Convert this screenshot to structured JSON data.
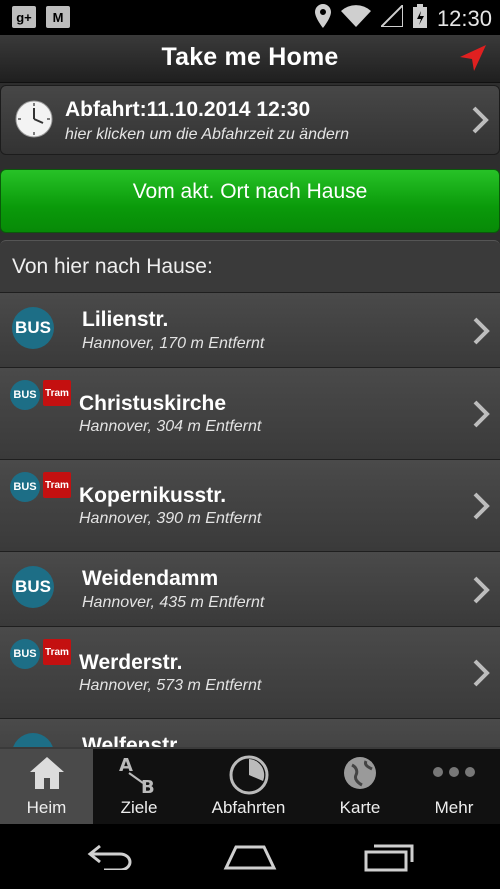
{
  "status_bar": {
    "time": "12:30"
  },
  "app_bar": {
    "title": "Take me Home"
  },
  "departure": {
    "title": "Abfahrt:11.10.2014 12:30",
    "subtitle": "hier klicken um die Abfahrzeit zu ändern"
  },
  "go_home_button": {
    "label": "Vom akt. Ort nach Hause"
  },
  "list": {
    "header": "Von hier nach Hause:",
    "items": [
      {
        "name": "Lilienstr.",
        "detail": "Hannover, 170 m Entfernt",
        "bus": "BUS",
        "tram": ""
      },
      {
        "name": "Christuskirche",
        "detail": "Hannover, 304 m Entfernt",
        "bus": "BUS",
        "tram": "Tram"
      },
      {
        "name": "Kopernikusstr.",
        "detail": "Hannover, 390 m Entfernt",
        "bus": "BUS",
        "tram": "Tram"
      },
      {
        "name": "Weidendamm",
        "detail": "Hannover, 435 m Entfernt",
        "bus": "BUS",
        "tram": ""
      },
      {
        "name": "Werderstr.",
        "detail": "Hannover, 573 m Entfernt",
        "bus": "BUS",
        "tram": "Tram"
      },
      {
        "name": "Welfenstr.",
        "detail": "",
        "bus": "BUS",
        "tram": ""
      }
    ]
  },
  "bottom_nav": {
    "items": [
      {
        "label": "Heim",
        "icon": "home-icon",
        "active": true
      },
      {
        "label": "Ziele",
        "icon": "a-to-b-icon",
        "active": false
      },
      {
        "label": "Abfahrten",
        "icon": "clock-pie-icon",
        "active": false
      },
      {
        "label": "Karte",
        "icon": "globe-icon",
        "active": false
      },
      {
        "label": "Mehr",
        "icon": "more-dots-icon",
        "active": false
      }
    ]
  },
  "colors": {
    "accent_green": "#0a9a0a",
    "bus_blue": "#1d6e86",
    "tram_red": "#c41010",
    "location_red": "#e02020"
  }
}
